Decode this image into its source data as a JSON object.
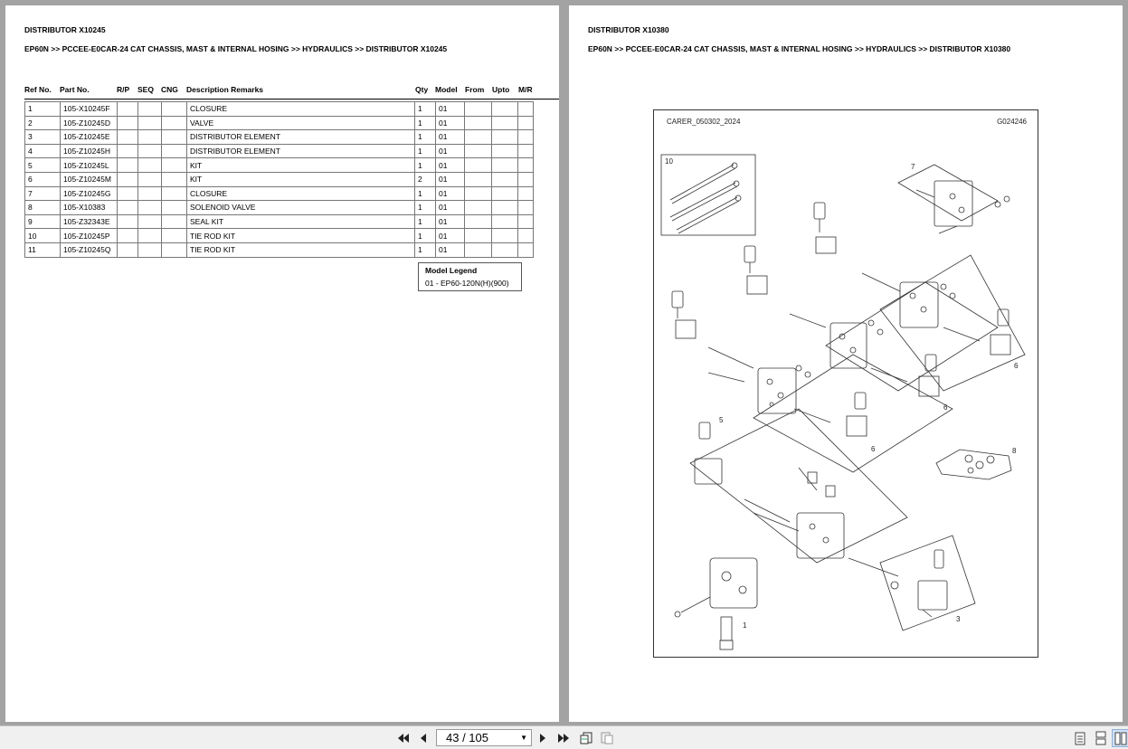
{
  "left_page": {
    "title": "DISTRIBUTOR X10245",
    "breadcrumb": "EP60N >> PCCEE-E0CAR-24 CAT CHASSIS, MAST & INTERNAL HOSING >> HYDRAULICS >> DISTRIBUTOR X10245",
    "columns": [
      "Ref No.",
      "Part No.",
      "R/P",
      "SEQ",
      "CNG",
      "Description Remarks",
      "Qty",
      "Model",
      "From",
      "Upto",
      "M/R"
    ],
    "rows": [
      {
        "ref": "1",
        "part": "105-X10245F",
        "desc": "CLOSURE",
        "qty": "1",
        "model": "01"
      },
      {
        "ref": "2",
        "part": "105-Z10245D",
        "desc": "VALVE",
        "qty": "1",
        "model": "01"
      },
      {
        "ref": "3",
        "part": "105-Z10245E",
        "desc": "DISTRIBUTOR ELEMENT",
        "qty": "1",
        "model": "01"
      },
      {
        "ref": "4",
        "part": "105-Z10245H",
        "desc": "DISTRIBUTOR ELEMENT",
        "qty": "1",
        "model": "01"
      },
      {
        "ref": "5",
        "part": "105-Z10245L",
        "desc": "KIT",
        "qty": "1",
        "model": "01"
      },
      {
        "ref": "6",
        "part": "105-Z10245M",
        "desc": "KIT",
        "qty": "2",
        "model": "01"
      },
      {
        "ref": "7",
        "part": "105-Z10245G",
        "desc": "CLOSURE",
        "qty": "1",
        "model": "01"
      },
      {
        "ref": "8",
        "part": "105-X10383",
        "desc": "SOLENOID VALVE",
        "qty": "1",
        "model": "01"
      },
      {
        "ref": "9",
        "part": "105-Z32343E",
        "desc": "SEAL KIT",
        "qty": "1",
        "model": "01"
      },
      {
        "ref": "10",
        "part": "105-Z10245P",
        "desc": "TIE ROD KIT",
        "qty": "1",
        "model": "01"
      },
      {
        "ref": "11",
        "part": "105-Z10245Q",
        "desc": "TIE ROD KIT",
        "qty": "1",
        "model": "01"
      }
    ],
    "legend": {
      "title": "Model Legend",
      "entry": "01 - EP60-120N(H)(900)"
    }
  },
  "right_page": {
    "title": "DISTRIBUTOR X10380",
    "breadcrumb": "EP60N >> PCCEE-E0CAR-24 CAT CHASSIS, MAST & INTERNAL HOSING >> HYDRAULICS >> DISTRIBUTOR X10380",
    "diagram": {
      "code_left": "CARER_050302_2024",
      "code_right": "G024246",
      "callouts": [
        "10",
        "7",
        "6",
        "6",
        "6",
        "5",
        "8",
        "1",
        "3"
      ]
    }
  },
  "toolbar": {
    "page_indicator": "43 / 105"
  }
}
